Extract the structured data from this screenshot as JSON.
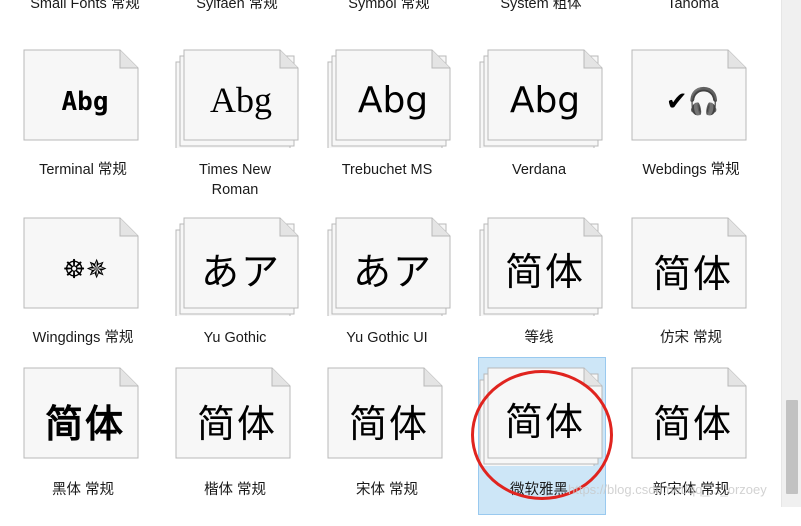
{
  "top_labels": [
    "Small Fonts 常规",
    "Sylfaen 常规",
    "Symbol 常规",
    "System 粗体",
    "Tahoma"
  ],
  "rows": [
    {
      "items": [
        {
          "name": "Terminal 常规",
          "sample": "Abg",
          "stacked": false
        },
        {
          "name": "Times New Roman",
          "sample": "Abg",
          "stacked": true
        },
        {
          "name": "Trebuchet MS",
          "sample": "Abg",
          "stacked": true
        },
        {
          "name": "Verdana",
          "sample": "Abg",
          "stacked": true
        },
        {
          "name": "Webdings 常规",
          "sample": "✔🎧",
          "stacked": false
        }
      ]
    },
    {
      "items": [
        {
          "name": "Wingdings 常规",
          "sample": "☸✵",
          "stacked": false
        },
        {
          "name": "Yu Gothic",
          "sample": "あア",
          "stacked": true
        },
        {
          "name": "Yu Gothic UI",
          "sample": "あア",
          "stacked": true
        },
        {
          "name": "等线",
          "sample": "简体",
          "stacked": true
        },
        {
          "name": "仿宋 常规",
          "sample": "简体",
          "stacked": false
        }
      ]
    },
    {
      "items": [
        {
          "name": "黑体 常规",
          "sample": "简体",
          "stacked": false
        },
        {
          "name": "楷体 常规",
          "sample": "简体",
          "stacked": false
        },
        {
          "name": "宋体 常规",
          "sample": "简体",
          "stacked": false
        },
        {
          "name": "微软雅黑",
          "sample": "简体",
          "stacked": true,
          "selected": true
        },
        {
          "name": "新宋体 常规",
          "sample": "简体",
          "stacked": false
        }
      ]
    }
  ],
  "watermark": "https://blog.csdn.net/qq_..._orzoey",
  "colors": {
    "selection": "#cde6f7",
    "highlight_circle": "#e0241f"
  }
}
